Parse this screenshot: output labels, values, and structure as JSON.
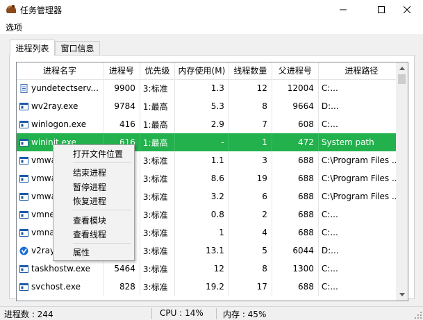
{
  "window": {
    "title": "任务管理器"
  },
  "menu": {
    "options": "选项"
  },
  "tabs": [
    {
      "label": "进程列表",
      "active": true
    },
    {
      "label": "窗口信息",
      "active": false
    }
  ],
  "table": {
    "columns": [
      "进程名字",
      "进程号",
      "优先级",
      "内存使用(M)",
      "线程数量",
      "父进程号",
      "进程路径"
    ],
    "rows": [
      {
        "name": "yundetectserv...",
        "pid": "9900",
        "priority": "3:标准",
        "memory": "1.3",
        "threads": "12",
        "ppid": "12004",
        "path": "C:...",
        "icon": "document-icon"
      },
      {
        "name": "wv2ray.exe",
        "pid": "9784",
        "priority": "1:最高",
        "memory": "5.3",
        "threads": "8",
        "ppid": "9664",
        "path": "D:...",
        "icon": "app-window-icon"
      },
      {
        "name": "winlogon.exe",
        "pid": "416",
        "priority": "1:最高",
        "memory": "2.9",
        "threads": "7",
        "ppid": "608",
        "path": "C:...",
        "icon": "app-window-icon"
      },
      {
        "name": "wininit.exe",
        "pid": "616",
        "priority": "1:最高",
        "memory": "-",
        "threads": "1",
        "ppid": "472",
        "path": "System path",
        "icon": "app-window-icon",
        "selected": true
      },
      {
        "name": "vmwa",
        "pid": "",
        "priority": "3:标准",
        "memory": "1.1",
        "threads": "3",
        "ppid": "688",
        "path": "C:\\Program Files ...",
        "icon": "app-window-icon"
      },
      {
        "name": "vmwa",
        "pid": "",
        "priority": "3:标准",
        "memory": "8.6",
        "threads": "19",
        "ppid": "688",
        "path": "C:\\Program Files ...",
        "icon": "app-window-icon"
      },
      {
        "name": "vmwa",
        "pid": "",
        "priority": "3:标准",
        "memory": "3.2",
        "threads": "6",
        "ppid": "688",
        "path": "C:\\Program Files ...",
        "icon": "app-window-icon"
      },
      {
        "name": "vmne",
        "pid": "",
        "priority": "3:标准",
        "memory": "0.8",
        "threads": "2",
        "ppid": "688",
        "path": "C:...",
        "icon": "app-window-icon"
      },
      {
        "name": "vmna",
        "pid": "",
        "priority": "3:标准",
        "memory": "1",
        "threads": "4",
        "ppid": "688",
        "path": "C:...",
        "icon": "app-window-icon"
      },
      {
        "name": "v2ray",
        "pid": "",
        "priority": "3:标准",
        "memory": "13.1",
        "threads": "5",
        "ppid": "6044",
        "path": "D:...",
        "icon": "v2ray-logo-icon"
      },
      {
        "name": "taskhostw.exe",
        "pid": "5464",
        "priority": "3:标准",
        "memory": "12",
        "threads": "8",
        "ppid": "1300",
        "path": "C:...",
        "icon": "app-window-icon"
      },
      {
        "name": "svchost.exe",
        "pid": "828",
        "priority": "3:标准",
        "memory": "19.2",
        "threads": "17",
        "ppid": "688",
        "path": "C:...",
        "icon": "app-window-icon"
      }
    ]
  },
  "context_menu": {
    "items": [
      "打开文件位置",
      "结束进程",
      "暂停进程",
      "恢复进程",
      "查看模块",
      "查看线程",
      "属性"
    ]
  },
  "status": {
    "process_count": "进程数 : 244",
    "cpu": "CPU : 14%",
    "memory": "内存 : 45%"
  },
  "colors": {
    "selection": "#22b14c",
    "window_bg": "#f0f0f0"
  }
}
